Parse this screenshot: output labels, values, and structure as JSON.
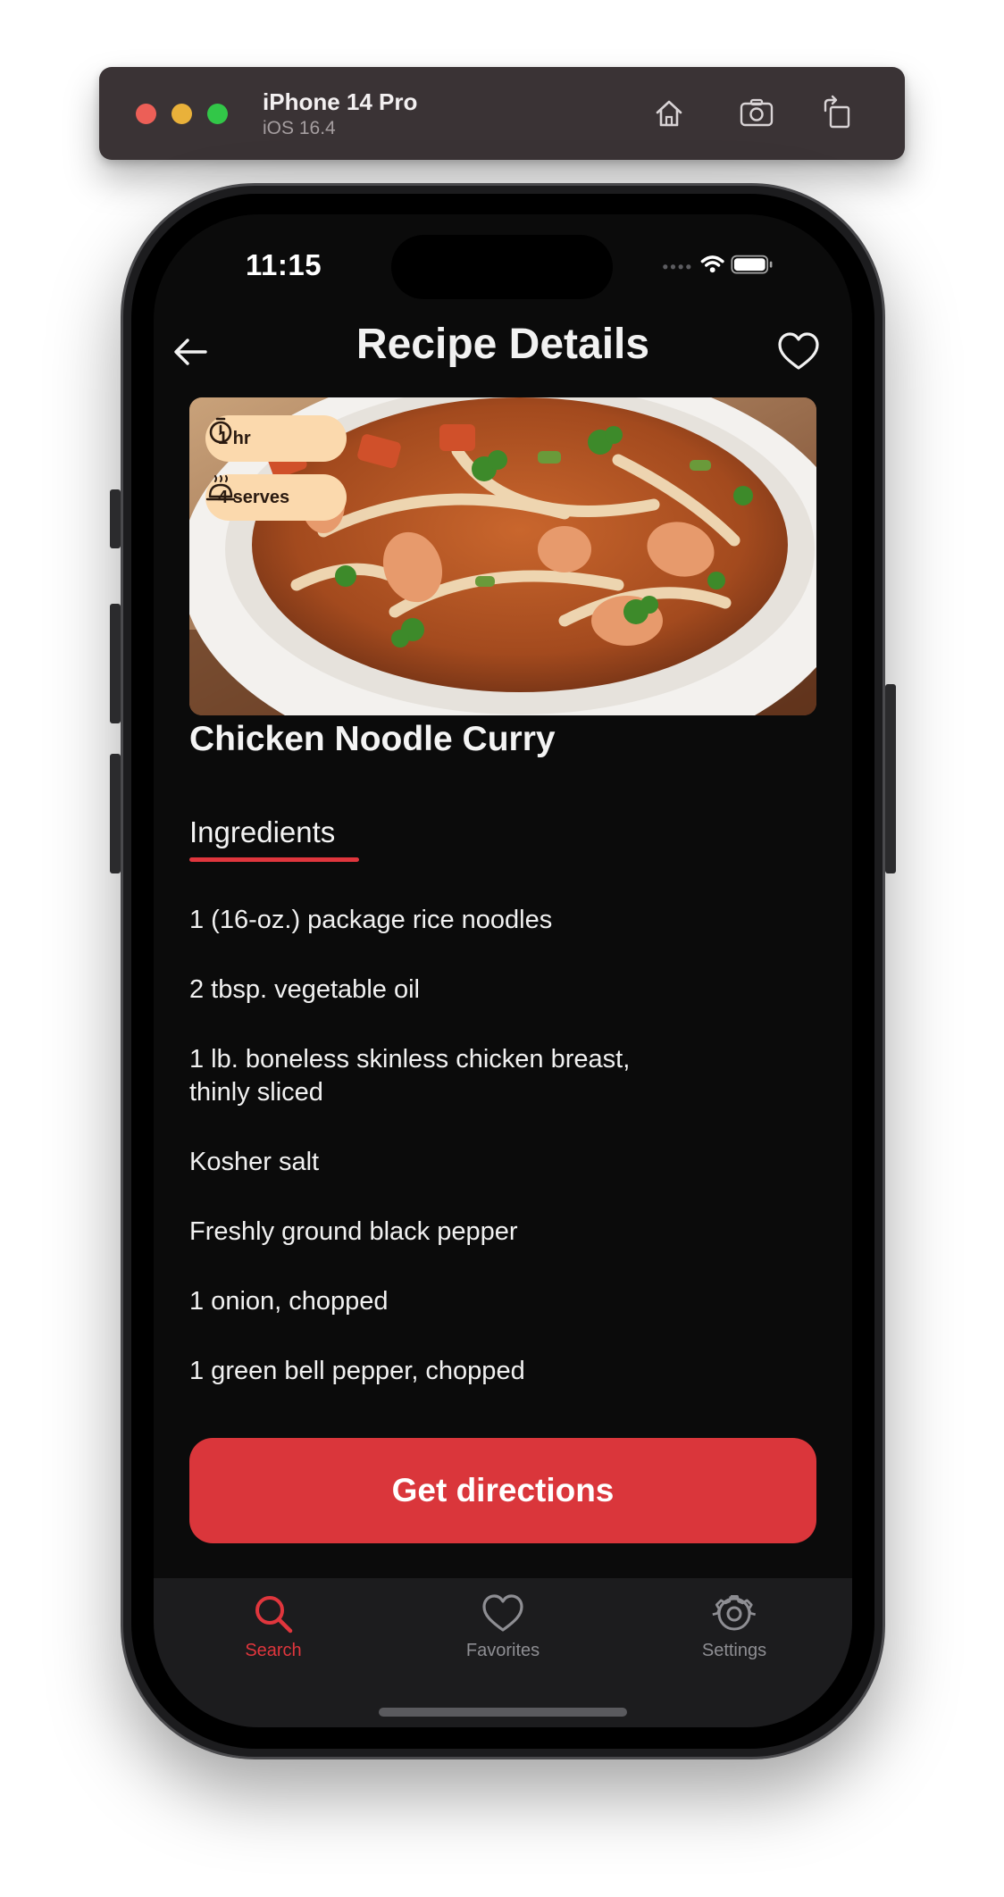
{
  "simulator": {
    "device_name": "iPhone 14 Pro",
    "os_version": "iOS 16.4",
    "buttons": [
      "home-icon",
      "screenshot-icon",
      "rotate-icon"
    ]
  },
  "status_bar": {
    "time": "11:15"
  },
  "header": {
    "title": "Recipe Details",
    "back_icon": "arrow-left-icon",
    "favorite_icon": "heart-icon"
  },
  "recipe": {
    "image": "chicken noodle curry dish",
    "chips": {
      "time": "1 hr",
      "serves": "4 serves"
    },
    "title": "Chicken Noodle Curry"
  },
  "ingredients_section": {
    "title": "Ingredients",
    "items": [
      "1 (16-oz.) package rice noodles",
      "2 tbsp. vegetable oil",
      "1 lb. boneless skinless chicken breast, thinly sliced",
      "Kosher salt",
      "Freshly ground black pepper",
      "1 onion, chopped",
      "1 green bell pepper, chopped"
    ]
  },
  "cta": {
    "label": "Get directions"
  },
  "tabbar": {
    "tabs": [
      {
        "label": "Search",
        "icon": "search-icon",
        "active": true
      },
      {
        "label": "Favorites",
        "icon": "heart-icon",
        "active": false
      },
      {
        "label": "Settings",
        "icon": "gear-icon",
        "active": false
      }
    ]
  },
  "colors": {
    "accent": "#e0363d",
    "background": "#0b0b0b",
    "chip": "#fbd9ad",
    "tabbar": "#1c1c1e"
  }
}
